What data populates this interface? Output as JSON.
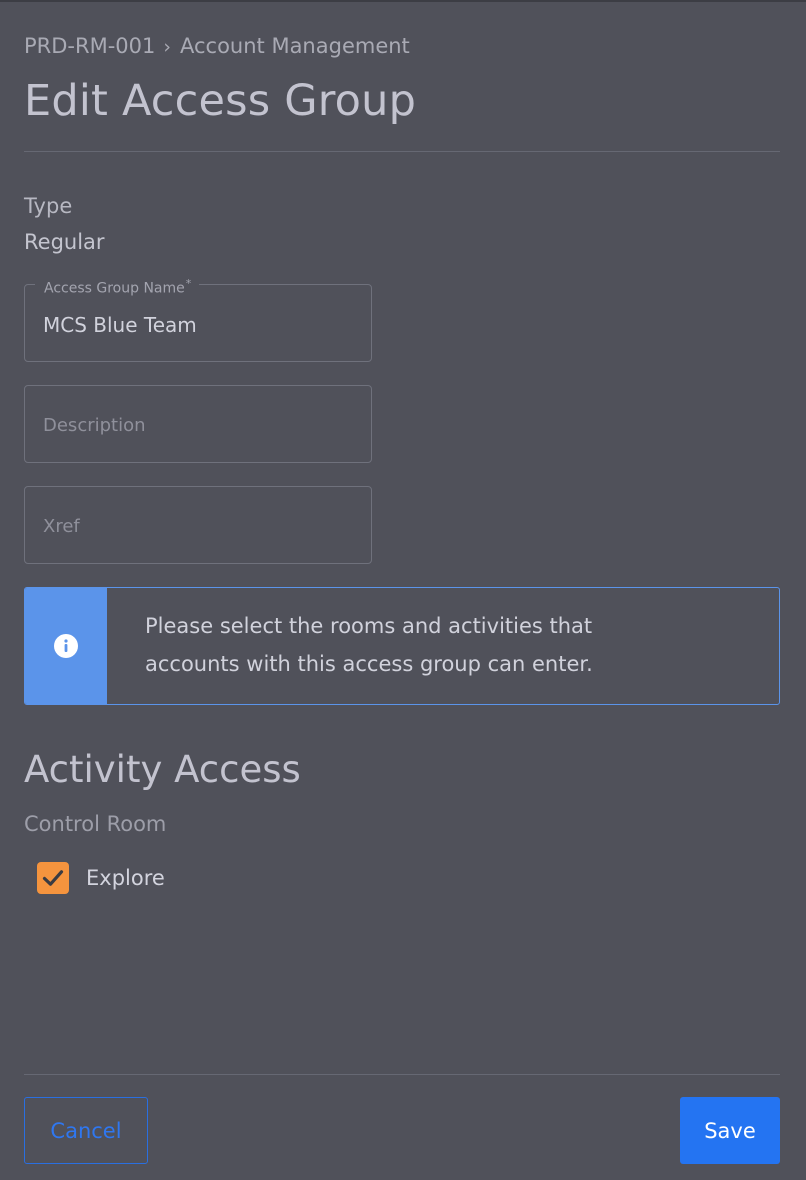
{
  "breadcrumb": {
    "code": "PRD-RM-001",
    "separator": "›",
    "section": "Account Management"
  },
  "page_title": "Edit Access Group",
  "type": {
    "label": "Type",
    "value": "Regular"
  },
  "fields": {
    "name": {
      "label": "Access Group Name",
      "required_marker": "*",
      "value": "MCS Blue Team"
    },
    "description": {
      "placeholder": "Description",
      "value": ""
    },
    "xref": {
      "placeholder": "Xref",
      "value": ""
    }
  },
  "info": {
    "icon": "info-icon",
    "line1": "Please select the rooms and activities that",
    "line2": "accounts with this access group can enter."
  },
  "activity_access": {
    "title": "Activity Access",
    "group": "Control Room",
    "items": [
      {
        "label": "Explore",
        "checked": true
      }
    ]
  },
  "actions": {
    "cancel_label": "Cancel",
    "save_label": "Save"
  },
  "colors": {
    "background": "#50515a",
    "accent_blue": "#2474f2",
    "info_blue": "#5b94ea",
    "checkbox_orange": "#f5943e"
  }
}
